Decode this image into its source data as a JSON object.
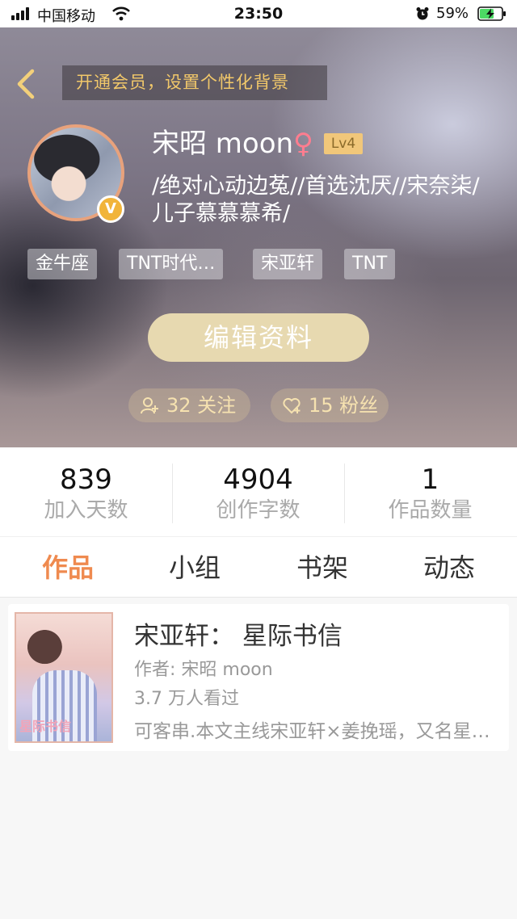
{
  "status_bar": {
    "carrier": "中国移动",
    "time": "23:50",
    "battery_percent": "59%"
  },
  "header": {
    "vip_banner": "开通会员，设置个性化背景",
    "username": "宋昭 moon",
    "gender_symbol": "♀",
    "level": "Lv4",
    "signature": "/绝对心动边菟//首选沈厌//宋奈柒/儿子慕慕慕希/",
    "tags": [
      "金牛座",
      "TNT时代…",
      "宋亚轩",
      "TNT"
    ],
    "edit_button": "编辑资料",
    "following": "32 关注",
    "followers": "15 粉丝"
  },
  "stats": [
    {
      "value": "839",
      "label": "加入天数"
    },
    {
      "value": "4904",
      "label": "创作字数"
    },
    {
      "value": "1",
      "label": "作品数量"
    }
  ],
  "tabs": [
    "作品",
    "小组",
    "书架",
    "动态"
  ],
  "active_tab": "作品",
  "works": [
    {
      "title": "宋亚轩：  星际书信",
      "author": "作者: 宋昭 moon",
      "views": "3.7 万人看过",
      "description": "可客串.本文主线宋亚轩×姜挽瑶，又名星际书信"
    }
  ],
  "colors": {
    "accent": "#ef8a4f",
    "vip_text": "#f2c86a",
    "level_badge": "#f1c77a",
    "edit_button": "#e7d9b0",
    "pill_text": "#f6e2b0"
  }
}
